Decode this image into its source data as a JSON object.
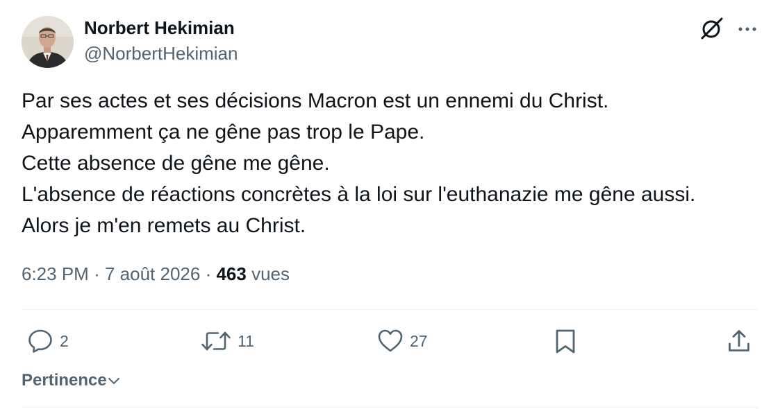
{
  "author": {
    "display_name": "Norbert Hekimian",
    "handle": "@NorbertHekimian",
    "avatar_icon": "user-photo"
  },
  "tweet": {
    "lines": [
      "Par ses actes et ses décisions Macron est un ennemi du Christ.",
      "Apparemment ça ne gêne pas trop le Pape.",
      "Cette absence de gêne me gêne.",
      "L'absence de réactions concrètes à la loi sur l'euthanazie me gêne aussi.",
      "Alors je m'en remets au Christ."
    ],
    "time": "6:23 PM",
    "date": "7 août 2026",
    "separator": "·",
    "views_count": "463",
    "views_label": "vues"
  },
  "actions": {
    "replies": "2",
    "retweets": "11",
    "likes": "27"
  },
  "icons": {
    "grok": "grok-icon",
    "more": "more-icon",
    "reply": "reply-icon",
    "retweet": "retweet-icon",
    "like": "heart-icon",
    "bookmark": "bookmark-icon",
    "share": "share-icon",
    "chevron": "chevron-down-icon"
  },
  "sort": {
    "label": "Pertinence"
  },
  "colors": {
    "text": "#0f1419",
    "secondary": "#536471",
    "divider": "#eff3f4"
  }
}
